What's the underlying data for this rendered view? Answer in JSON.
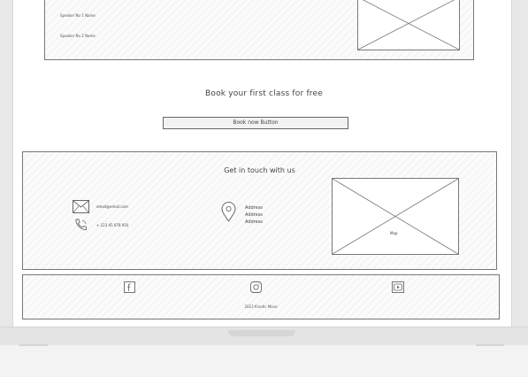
{
  "speakers": {
    "item_1": "Speaker No 1 Name",
    "item_2": "Speaker No 2 Name"
  },
  "cta": {
    "title": "Book your first class for free",
    "button_label": "Book now Button"
  },
  "contact": {
    "title": "Get in touch with us",
    "email": "email@email.com",
    "phone": "+ 123 45 678 910",
    "address_lines": [
      "Address",
      "Address",
      "Address"
    ],
    "map_label": "Map"
  },
  "footer": {
    "copyright": "2023 Kinetic Move",
    "social_icons": [
      "facebook-icon",
      "instagram-icon",
      "youtube-icon"
    ]
  },
  "colors": {
    "stroke": "#777777",
    "background": "#ffffff"
  }
}
